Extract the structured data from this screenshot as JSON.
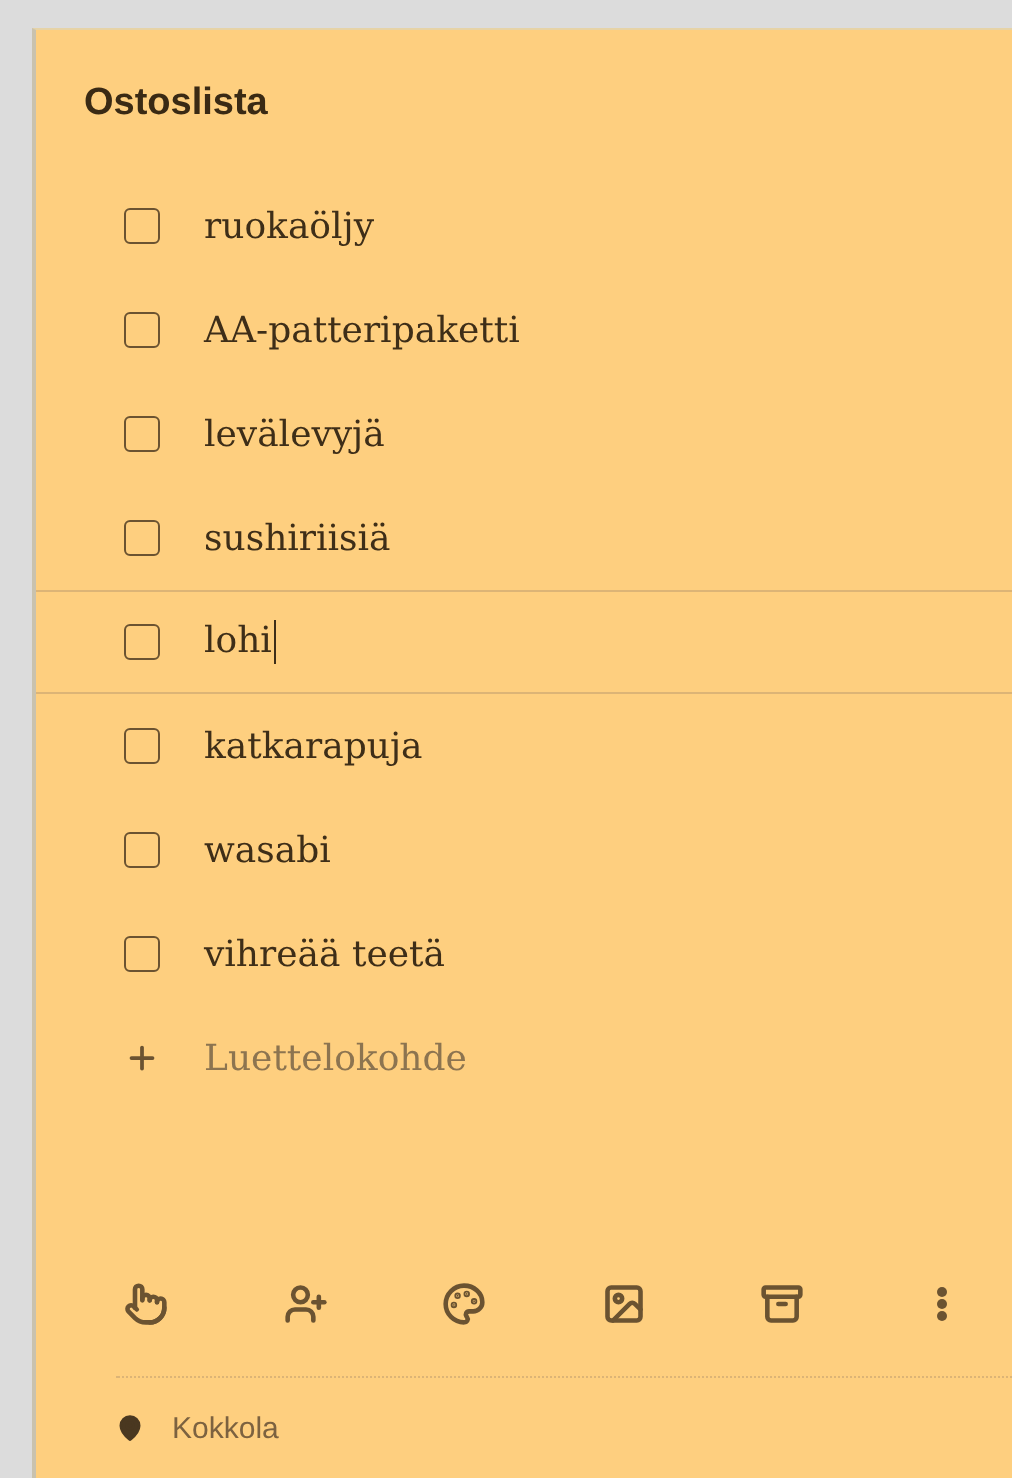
{
  "note": {
    "title": "Ostoslista",
    "items": [
      {
        "text": "ruokaöljy",
        "checked": false,
        "focused": false
      },
      {
        "text": "AA-patteripaketti",
        "checked": false,
        "focused": false
      },
      {
        "text": "levälevyjä",
        "checked": false,
        "focused": false
      },
      {
        "text": "sushiriisiä",
        "checked": false,
        "focused": false
      },
      {
        "text": "lohi",
        "checked": false,
        "focused": true
      },
      {
        "text": "katkarapuja",
        "checked": false,
        "focused": false
      },
      {
        "text": "wasabi",
        "checked": false,
        "focused": false
      },
      {
        "text": "vihreää teetä",
        "checked": false,
        "focused": false
      }
    ],
    "add_item": {
      "placeholder": "Luettelokohde"
    },
    "toolbar": [
      {
        "kind": "reminder"
      },
      {
        "kind": "collaborator"
      },
      {
        "kind": "color"
      },
      {
        "kind": "image"
      },
      {
        "kind": "archive"
      },
      {
        "kind": "more"
      }
    ],
    "location": "Kokkola"
  }
}
